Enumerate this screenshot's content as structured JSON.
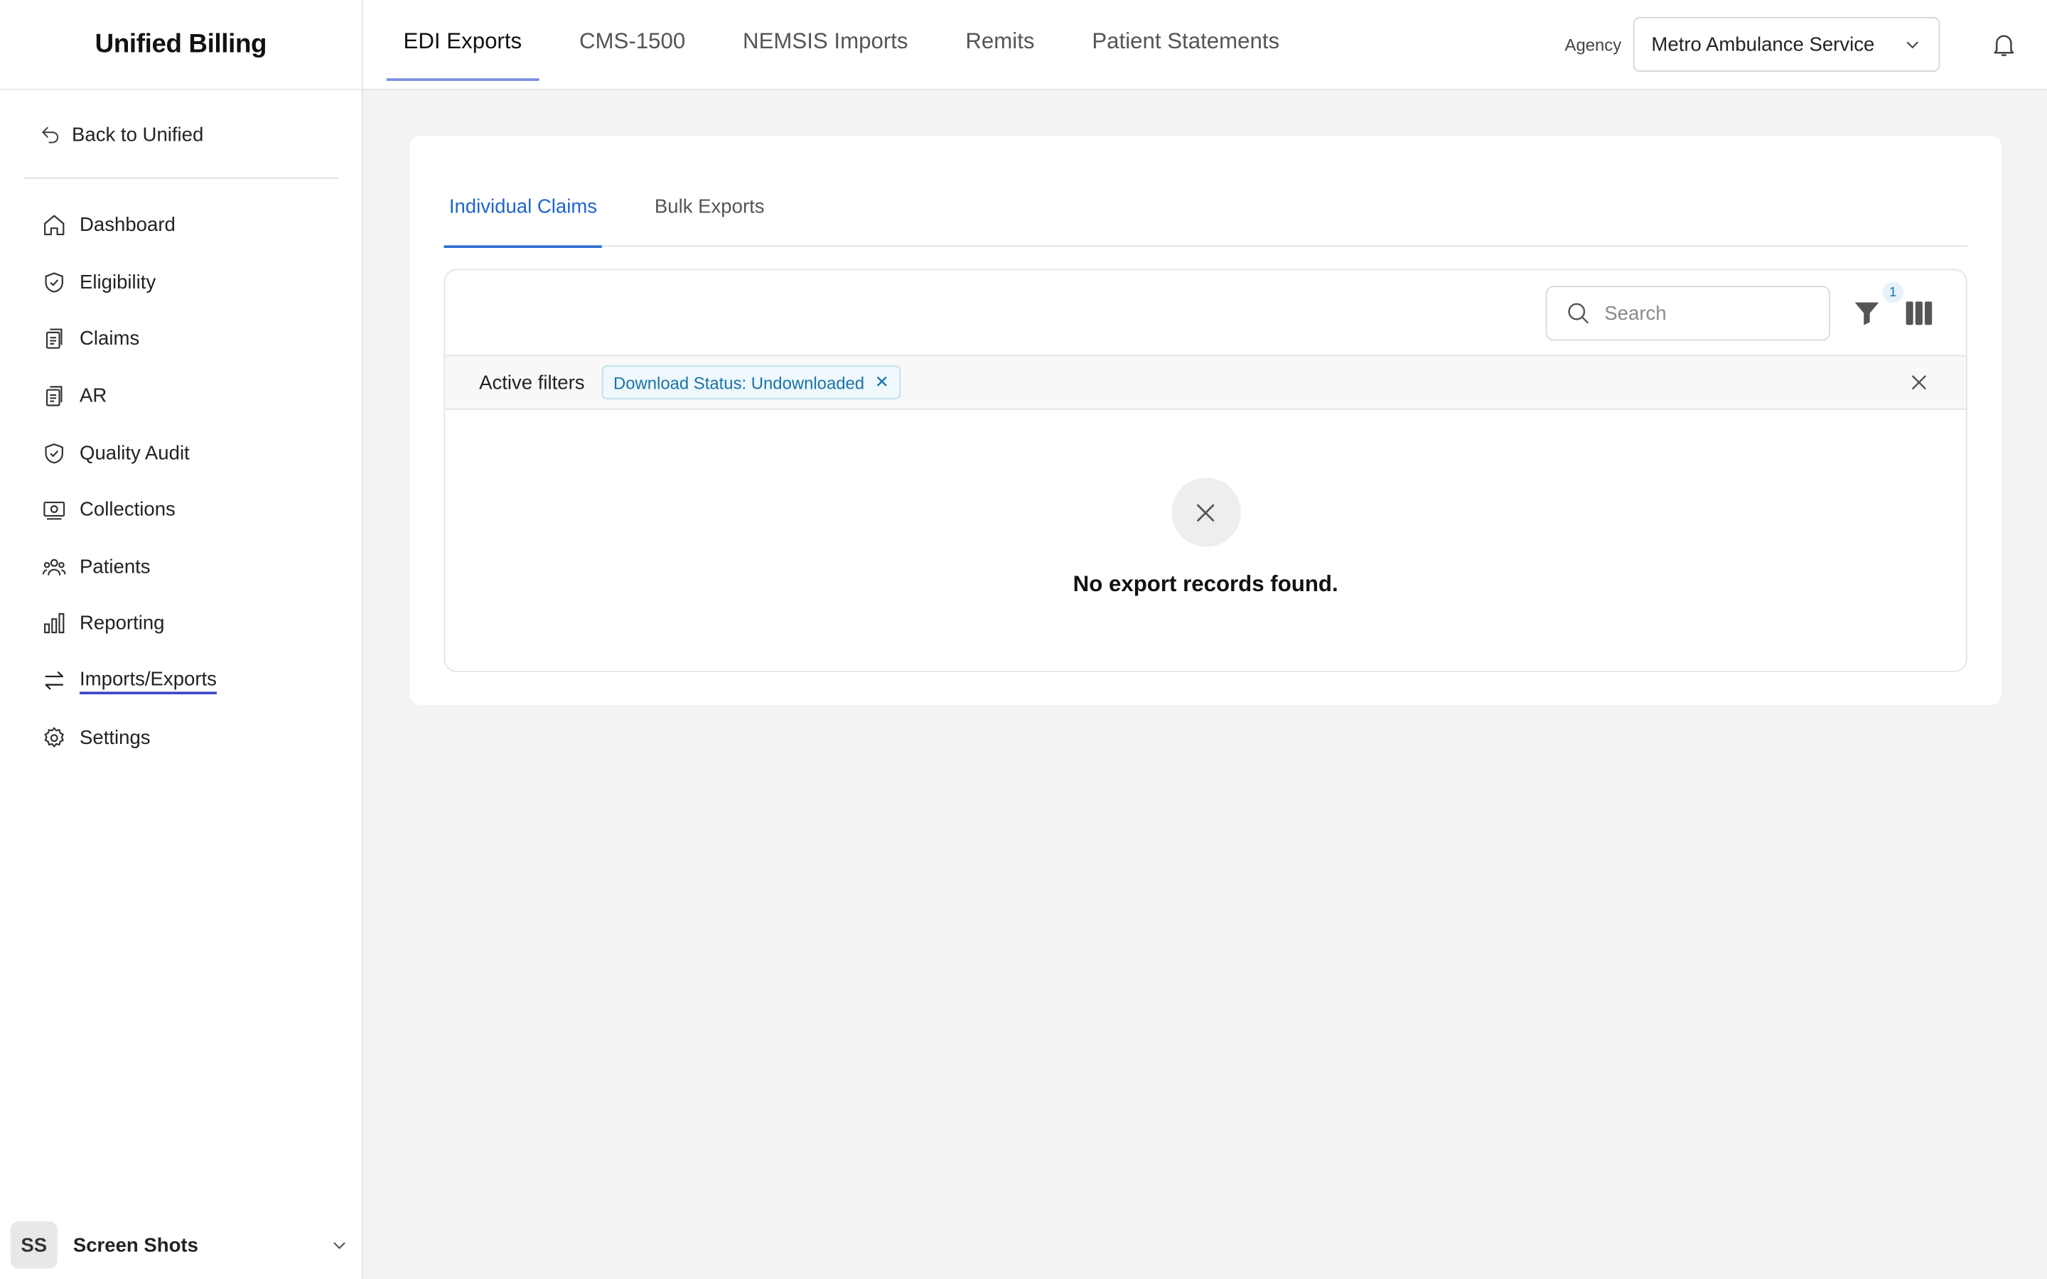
{
  "app": {
    "title": "Unified Billing"
  },
  "sidebar": {
    "back_label": "Back to Unified",
    "items": [
      {
        "label": "Dashboard",
        "icon": "home-icon"
      },
      {
        "label": "Eligibility",
        "icon": "shield-check-icon"
      },
      {
        "label": "Claims",
        "icon": "clipboard-icon"
      },
      {
        "label": "AR",
        "icon": "clipboard-icon"
      },
      {
        "label": "Quality Audit",
        "icon": "shield-check-icon"
      },
      {
        "label": "Collections",
        "icon": "money-icon"
      },
      {
        "label": "Patients",
        "icon": "users-icon"
      },
      {
        "label": "Reporting",
        "icon": "bar-chart-icon"
      },
      {
        "label": "Imports/Exports",
        "icon": "arrows-exchange-icon",
        "active": true
      },
      {
        "label": "Settings",
        "icon": "gear-icon"
      }
    ],
    "user": {
      "initials": "SS",
      "name": "Screen Shots"
    }
  },
  "header": {
    "tabs": [
      {
        "label": "EDI Exports",
        "active": true
      },
      {
        "label": "CMS-1500"
      },
      {
        "label": "NEMSIS Imports"
      },
      {
        "label": "Remits"
      },
      {
        "label": "Patient Statements"
      }
    ],
    "agency_label": "Agency",
    "agency_value": "Metro Ambulance Service"
  },
  "main": {
    "subtabs": [
      {
        "label": "Individual Claims",
        "active": true
      },
      {
        "label": "Bulk Exports"
      }
    ],
    "search": {
      "placeholder": "Search",
      "value": ""
    },
    "filter_count": "1",
    "active_filters_label": "Active filters",
    "filters": [
      {
        "label": "Download Status: Undownloaded"
      }
    ],
    "empty_message": "No export records found."
  },
  "colors": {
    "accent": "#2e6fd1",
    "chip_text": "#1b73a6",
    "nav_active_underline": "#3b46c4"
  }
}
